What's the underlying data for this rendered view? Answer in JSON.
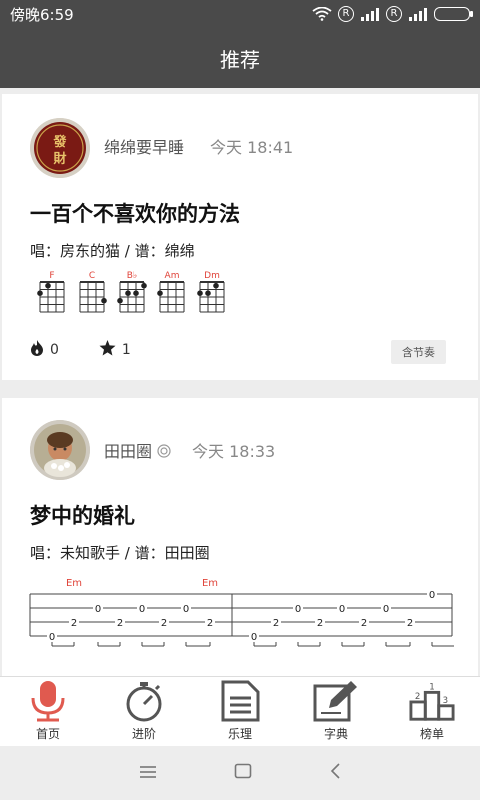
{
  "status": {
    "time": "傍晚6:59",
    "r1": "R",
    "r2": "R"
  },
  "header": {
    "title": "推荐"
  },
  "posts": [
    {
      "author": "绵绵要早睡",
      "time": "今天 18:41",
      "avatar_text": "發 財",
      "song_title": "一百个不喜欢你的方法",
      "credits": "唱：房东的猫 / 谱：绵绵",
      "chords": [
        "F",
        "C",
        "B♭",
        "Am",
        "Dm"
      ],
      "hot_count": "0",
      "star_count": "1",
      "tag": "含节奏"
    },
    {
      "author": "田田圈",
      "time": "今天 18:33",
      "song_title": "梦中的婚礼",
      "credits": "唱：未知歌手 / 谱：田田圈",
      "tab_chords": [
        "Em",
        "Em"
      ],
      "tab_numbers": [
        "0",
        "0",
        "0",
        "0",
        "0",
        "0",
        "0",
        "0",
        "0",
        "2",
        "2",
        "2",
        "2",
        "2",
        "2",
        "2",
        "2",
        "0",
        "0"
      ]
    }
  ],
  "nav": {
    "home": "首页",
    "advanced": "进阶",
    "theory": "乐理",
    "dictionary": "字典",
    "ranking": "榜单"
  },
  "colors": {
    "accent": "#e05a4f",
    "bar": "#4a4a4a",
    "chord_red": "#e0443a"
  }
}
